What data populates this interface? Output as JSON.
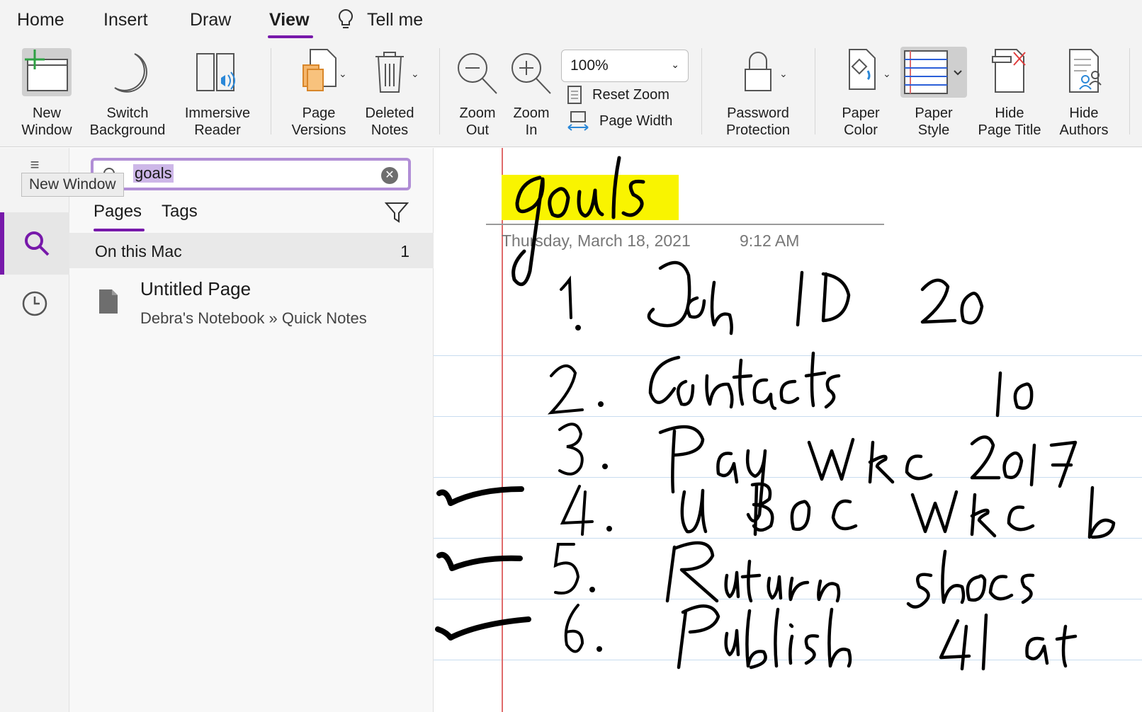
{
  "tabs": [
    {
      "label": "Home"
    },
    {
      "label": "Insert"
    },
    {
      "label": "Draw"
    },
    {
      "label": "View"
    },
    {
      "label": "Tell me"
    }
  ],
  "ribbon": {
    "new_window": "New\nWindow",
    "switch_background": "Switch\nBackground",
    "immersive_reader": "Immersive\nReader",
    "page_versions": "Page\nVersions",
    "deleted_notes": "Deleted\nNotes",
    "zoom_out": "Zoom\nOut",
    "zoom_in": "Zoom\nIn",
    "zoom_value": "100%",
    "reset_zoom": "Reset Zoom",
    "page_width": "Page Width",
    "password_protection": "Password\nProtection",
    "paper_color": "Paper\nColor",
    "paper_style": "Paper\nStyle",
    "hide_page_title": "Hide\nPage Title",
    "hide_authors": "Hide\nAuthors"
  },
  "tooltip": "New Window",
  "search": {
    "query": "goals",
    "tabs": [
      "Pages",
      "Tags"
    ],
    "location": "On this Mac",
    "location_count": "1",
    "results": [
      {
        "title": "Untitled Page",
        "path": "Debra's Notebook » Quick Notes"
      }
    ]
  },
  "page": {
    "title": "goals",
    "date": "Thursday, March 18, 2021",
    "time": "9:12 AM",
    "handwritten_lines": [
      "1. Job ID  20",
      "2. Contacts  10",
      "3. Pay WRC 2017",
      "4. UBOC WRC b",
      "5. Return shoes",
      "6. Publish 4 art"
    ],
    "checked_lines": [
      4,
      5,
      6
    ]
  },
  "colors": {
    "accent": "#7719aa",
    "highlight": "#f9f400",
    "margin_line": "#e06b6b"
  }
}
